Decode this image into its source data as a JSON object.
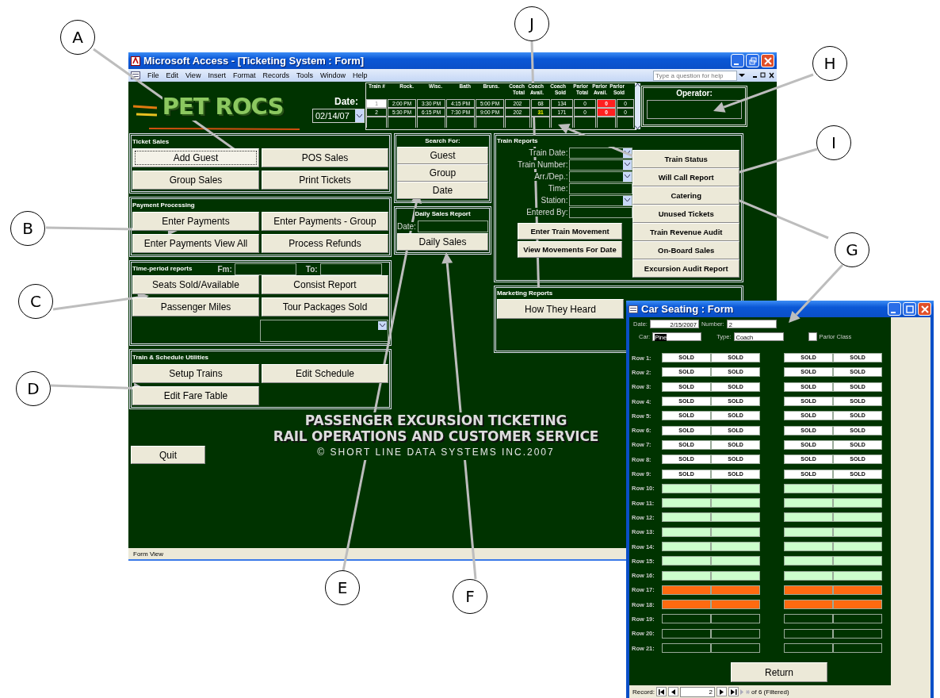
{
  "callouts": [
    {
      "letter": "A"
    },
    {
      "letter": "B"
    },
    {
      "letter": "C"
    },
    {
      "letter": "D"
    },
    {
      "letter": "E"
    },
    {
      "letter": "F"
    },
    {
      "letter": "G"
    },
    {
      "letter": "H"
    },
    {
      "letter": "I"
    },
    {
      "letter": "J"
    }
  ],
  "window": {
    "title": "Microsoft Access - [Ticketing System : Form]"
  },
  "menu": [
    "File",
    "Edit",
    "View",
    "Insert",
    "Format",
    "Records",
    "Tools",
    "Window",
    "Help"
  ],
  "help_search": {
    "placeholder": "Type a question for help"
  },
  "header": {
    "logo": "PET ROCS",
    "date_label": "Date:",
    "date_value": "02/14/07",
    "operator_label": "Operator:"
  },
  "train_grid": {
    "columns": [
      "Train #",
      "Rock.",
      "Wisc.",
      "Bath",
      "Bruns.",
      "Coach Total",
      "Coach Avail.",
      "Coach Sold",
      "Parlor Total",
      "Parlor Avail.",
      "Parlor Sold"
    ],
    "rows": [
      {
        "selected": true,
        "coach_alert": false,
        "parlor_alert": true,
        "cells": [
          "1",
          "2:00 PM",
          "3:30 PM",
          "4:15 PM",
          "5:00 PM",
          "202",
          "68",
          "134",
          "0",
          "0",
          "0"
        ]
      },
      {
        "selected": false,
        "coach_alert": true,
        "parlor_alert": true,
        "cells": [
          "2",
          "5:30 PM",
          "6:15 PM",
          "7:30 PM",
          "9:00 PM",
          "202",
          "31",
          "171",
          "0",
          "0",
          "0"
        ]
      }
    ]
  },
  "left_panels": [
    {
      "title": "Ticket Sales",
      "buttons": [
        {
          "label": "Add Guest",
          "focused": true
        },
        {
          "label": "POS Sales",
          "focused": false
        },
        {
          "label": "Group Sales",
          "focused": false
        },
        {
          "label": "Print Tickets",
          "focused": false
        }
      ]
    },
    {
      "title": "Payment Processing",
      "buttons": [
        {
          "label": "Enter Payments",
          "focused": false
        },
        {
          "label": "Enter Payments - Group",
          "focused": false
        },
        {
          "label": "Enter Payments View All",
          "focused": false
        },
        {
          "label": "Process Refunds",
          "focused": false
        }
      ]
    },
    {
      "title": "Time-period reports",
      "range": {
        "from_label": "Fm:",
        "to_label": "To:"
      },
      "buttons": [
        {
          "label": "Seats Sold/Available",
          "focused": false
        },
        {
          "label": "Consist Report",
          "focused": false
        },
        {
          "label": "Passenger Miles",
          "focused": false
        },
        {
          "label": "Tour Packages Sold",
          "focused": false
        }
      ],
      "dropdown": true
    },
    {
      "title": "Train & Schedule Utilities",
      "buttons": [
        {
          "label": "Setup Trains",
          "focused": false
        },
        {
          "label": "Edit Schedule",
          "focused": false
        },
        {
          "label": "Edit Fare Table",
          "focused": false
        }
      ]
    }
  ],
  "search_panel": {
    "title": "Search For:",
    "buttons": [
      "Guest",
      "Group",
      "Date"
    ]
  },
  "daily_sales": {
    "title": "Daily Sales Report",
    "date_label": "Date:",
    "button": "Daily Sales"
  },
  "train_reports": {
    "title": "Train Reports",
    "fields": [
      {
        "label": "Train Date:",
        "kind": "combo"
      },
      {
        "label": "Train Number:",
        "kind": "combo"
      },
      {
        "label": "Arr./Dep.:",
        "kind": "combo"
      },
      {
        "label": "Time:",
        "kind": "text"
      },
      {
        "label": "Station:",
        "kind": "combo"
      },
      {
        "label": "Entered By:",
        "kind": "text"
      }
    ],
    "buttons": [
      "Enter Train Movement",
      "View Movements For Date"
    ],
    "report_buttons": [
      "Train Status",
      "Will Call Report",
      "Catering",
      "Unused Tickets",
      "Train Revenue Audit",
      "On-Board Sales",
      "Excursion Audit Report"
    ]
  },
  "marketing": {
    "title": "Marketing Reports",
    "buttons": [
      "How They Heard"
    ]
  },
  "quit_button": "Quit",
  "banner": [
    "PASSENGER EXCURSION TICKETING",
    "RAIL OPERATIONS AND CUSTOMER SERVICE",
    "© SHORT LINE DATA SYSTEMS INC.2007"
  ],
  "status_bar": "Form View",
  "car_seating": {
    "title": "Car Seating : Form",
    "date_label": "Date:",
    "date": "2/15/2007",
    "number_label": "Number:",
    "number": "2",
    "car_label": "Car:",
    "car": "Pine",
    "type_label": "Type:",
    "type": "Coach",
    "parlor_class": {
      "label": "Parlor Class",
      "checked": false
    },
    "rows": [
      {
        "label": "Row 1:",
        "seats": [
          {
            "kind": "sold",
            "text": "SOLD"
          },
          {
            "kind": "sold",
            "text": "SOLD"
          },
          {
            "kind": "sold",
            "text": "SOLD"
          },
          {
            "kind": "sold",
            "text": "SOLD"
          }
        ]
      },
      {
        "label": "Row 2:",
        "seats": [
          {
            "kind": "sold",
            "text": "SOLD"
          },
          {
            "kind": "sold",
            "text": "SOLD"
          },
          {
            "kind": "sold",
            "text": "SOLD"
          },
          {
            "kind": "sold",
            "text": "SOLD"
          }
        ]
      },
      {
        "label": "Row 3:",
        "seats": [
          {
            "kind": "sold",
            "text": "SOLD"
          },
          {
            "kind": "sold",
            "text": "SOLD"
          },
          {
            "kind": "sold",
            "text": "SOLD"
          },
          {
            "kind": "sold",
            "text": "SOLD"
          }
        ]
      },
      {
        "label": "Row 4:",
        "seats": [
          {
            "kind": "sold",
            "text": "SOLD"
          },
          {
            "kind": "sold",
            "text": "SOLD"
          },
          {
            "kind": "sold",
            "text": "SOLD"
          },
          {
            "kind": "sold",
            "text": "SOLD"
          }
        ]
      },
      {
        "label": "Row 5:",
        "seats": [
          {
            "kind": "sold",
            "text": "SOLD"
          },
          {
            "kind": "sold",
            "text": "SOLD"
          },
          {
            "kind": "sold",
            "text": "SOLD"
          },
          {
            "kind": "sold",
            "text": "SOLD"
          }
        ]
      },
      {
        "label": "Row 6:",
        "seats": [
          {
            "kind": "sold",
            "text": "SOLD"
          },
          {
            "kind": "sold",
            "text": "SOLD"
          },
          {
            "kind": "sold",
            "text": "SOLD"
          },
          {
            "kind": "sold",
            "text": "SOLD"
          }
        ]
      },
      {
        "label": "Row 7:",
        "seats": [
          {
            "kind": "sold",
            "text": "SOLD"
          },
          {
            "kind": "sold",
            "text": "SOLD"
          },
          {
            "kind": "sold",
            "text": "SOLD"
          },
          {
            "kind": "sold",
            "text": "SOLD"
          }
        ]
      },
      {
        "label": "Row 8:",
        "seats": [
          {
            "kind": "sold",
            "text": "SOLD"
          },
          {
            "kind": "sold",
            "text": "SOLD"
          },
          {
            "kind": "sold",
            "text": "SOLD"
          },
          {
            "kind": "sold",
            "text": "SOLD"
          }
        ]
      },
      {
        "label": "Row 9:",
        "seats": [
          {
            "kind": "sold",
            "text": "SOLD"
          },
          {
            "kind": "sold",
            "text": "SOLD"
          },
          {
            "kind": "sold",
            "text": "SOLD"
          },
          {
            "kind": "sold",
            "text": "SOLD"
          }
        ]
      },
      {
        "label": "Row 10:",
        "seats": [
          {
            "kind": "open"
          },
          {
            "kind": "open"
          },
          {
            "kind": "open"
          },
          {
            "kind": "open"
          }
        ]
      },
      {
        "label": "Row 11:",
        "seats": [
          {
            "kind": "open"
          },
          {
            "kind": "open"
          },
          {
            "kind": "open"
          },
          {
            "kind": "open"
          }
        ]
      },
      {
        "label": "Row 12:",
        "seats": [
          {
            "kind": "open"
          },
          {
            "kind": "open"
          },
          {
            "kind": "open"
          },
          {
            "kind": "open"
          }
        ]
      },
      {
        "label": "Row 13:",
        "seats": [
          {
            "kind": "open"
          },
          {
            "kind": "open"
          },
          {
            "kind": "open"
          },
          {
            "kind": "open"
          }
        ]
      },
      {
        "label": "Row 14:",
        "seats": [
          {
            "kind": "open"
          },
          {
            "kind": "open"
          },
          {
            "kind": "open"
          },
          {
            "kind": "open"
          }
        ]
      },
      {
        "label": "Row 15:",
        "seats": [
          {
            "kind": "open"
          },
          {
            "kind": "open"
          },
          {
            "kind": "open"
          },
          {
            "kind": "open"
          }
        ]
      },
      {
        "label": "Row 16:",
        "seats": [
          {
            "kind": "open"
          },
          {
            "kind": "open"
          },
          {
            "kind": "open"
          },
          {
            "kind": "open"
          }
        ]
      },
      {
        "label": "Row 17:",
        "seats": [
          {
            "kind": "held"
          },
          {
            "kind": "held"
          },
          {
            "kind": "held"
          },
          {
            "kind": "held"
          }
        ]
      },
      {
        "label": "Row 18:",
        "seats": [
          {
            "kind": "held"
          },
          {
            "kind": "held"
          },
          {
            "kind": "held"
          },
          {
            "kind": "held"
          }
        ]
      },
      {
        "label": "Row 19:",
        "seats": [
          {
            "kind": "blank"
          },
          {
            "kind": "blank"
          },
          {
            "kind": "blank"
          },
          {
            "kind": "blank"
          }
        ]
      },
      {
        "label": "Row 20:",
        "seats": [
          {
            "kind": "blank"
          },
          {
            "kind": "blank"
          },
          {
            "kind": "blank"
          },
          {
            "kind": "blank"
          }
        ]
      },
      {
        "label": "Row 21:",
        "seats": [
          {
            "kind": "blank"
          },
          {
            "kind": "blank"
          },
          {
            "kind": "blank"
          },
          {
            "kind": "blank"
          }
        ]
      }
    ],
    "return_button": "Return",
    "record_nav": {
      "label": "Record:",
      "value": "2",
      "of": "of 6 (Filtered)"
    }
  }
}
